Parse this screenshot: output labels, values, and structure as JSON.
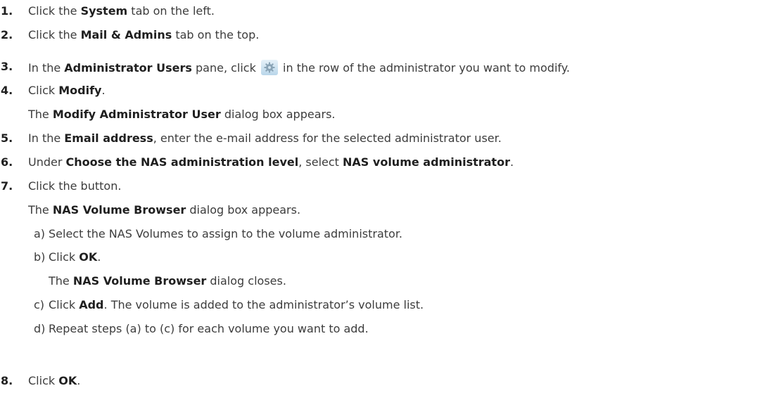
{
  "steps": [
    {
      "num": "1.",
      "pre": "Click the ",
      "bold": "System",
      "post": " tab on the left."
    },
    {
      "num": "2.",
      "pre": "Click the ",
      "bold": "Mail & Admins",
      "post": " tab on the top."
    },
    {
      "num": "3.",
      "pre": "In the ",
      "bold": "Administrator Users",
      "mid": " pane, click ",
      "post": " in the row of the administrator you want to modify.",
      "icon": "settings-gear-icon"
    },
    {
      "num": "4.",
      "pre": "Click ",
      "bold": "Modify",
      "post": "."
    },
    {
      "pre": "The ",
      "bold": "Modify Administrator User",
      "post": " dialog box appears."
    },
    {
      "num": "5.",
      "pre": "In the ",
      "bold": "Email address",
      "post": ", enter the e-mail address for the selected administrator user."
    },
    {
      "num": "6.",
      "pre": "Under ",
      "bold": "Choose the NAS administration level",
      "mid": ", select ",
      "bold2": "NAS volume administrator",
      "post": "."
    },
    {
      "num": "7.",
      "text": "Click the button."
    },
    {
      "pre": "The ",
      "bold": "NAS Volume Browser",
      "post": " dialog box appears."
    },
    {
      "num": "8.",
      "pre": "Click ",
      "bold": "OK",
      "post": "."
    }
  ],
  "substeps": [
    {
      "letter": "a)",
      "text": "Select the NAS Volumes to assign to the volume administrator."
    },
    {
      "letter": "b)",
      "pre": "Click ",
      "bold": "OK",
      "post": "."
    },
    {
      "pre": "The ",
      "bold": "NAS Volume Browser",
      "post": " dialog closes."
    },
    {
      "letter": "c)",
      "pre": "Click ",
      "bold": "Add",
      "post": ". The volume is added to the administrator’s volume list."
    },
    {
      "letter": "d)",
      "text": "Repeat steps (a) to (c) for each volume you want to add."
    }
  ]
}
